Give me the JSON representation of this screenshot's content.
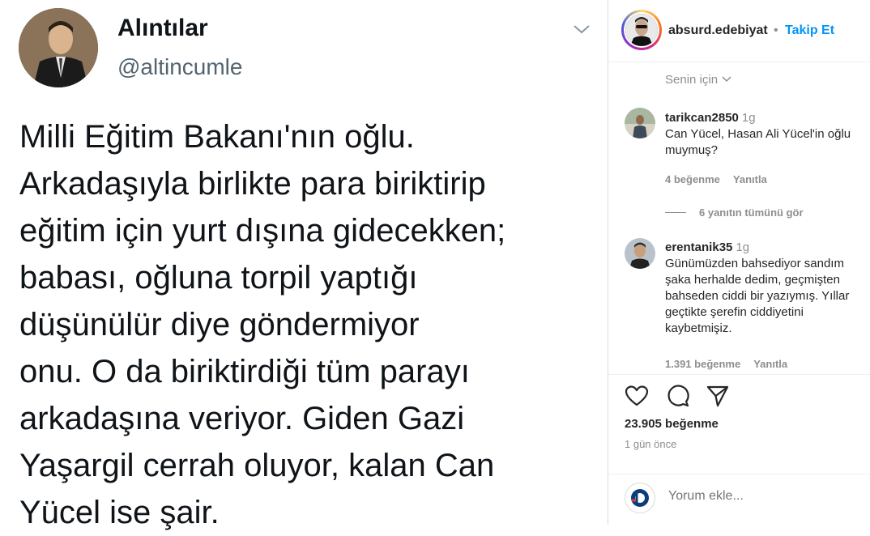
{
  "tweet": {
    "name": "Alıntılar",
    "handle": "@altincumle",
    "lines": [
      "Milli Eğitim Bakanı'nın oğlu.",
      "Arkadaşıyla birlikte para biriktirip",
      "eğitim için yurt dışına gidecekken;",
      "babası, oğluna torpil yaptığı",
      "düşünülür diye göndermiyor",
      "onu. O da biriktirdiği tüm parayı",
      "arkadaşına veriyor. Giden Gazi",
      "Yaşargil cerrah oluyor, kalan Can",
      "Yücel ise şair."
    ]
  },
  "post": {
    "username": "absurd.edebiyat",
    "dot": "•",
    "follow_label": "Takip Et",
    "for_you_label": "Senin için",
    "comments": [
      {
        "user": "tarikcan2850",
        "time": "1g",
        "lines": [
          "Can Yücel, Hasan Ali Yücel'in oğlu",
          "muymuş?"
        ],
        "likes": "4 beğenme",
        "reply_label": "Yanıtla"
      },
      {
        "user": "erentanik35",
        "time": "1g",
        "lines": [
          "Günümüzden bahsediyor sandım",
          "şaka herhalde dedim, geçmişten",
          "bahseden ciddi bir yazıymış. Yıllar",
          "geçtikte şerefin ciddiyetini",
          "kaybetmişiz."
        ],
        "likes": "1.391 beğenme",
        "reply_label": "Yanıtla"
      }
    ],
    "view_replies_label": "6 yanıtın tümünü gör",
    "like_count": "23.905 beğenme",
    "time_ago": "1 gün önce",
    "comment_placeholder": "Yorum ekle..."
  },
  "icons": [
    "chevron-down-icon",
    "heart-icon",
    "comment-icon",
    "share-icon",
    "emoji-icon"
  ]
}
